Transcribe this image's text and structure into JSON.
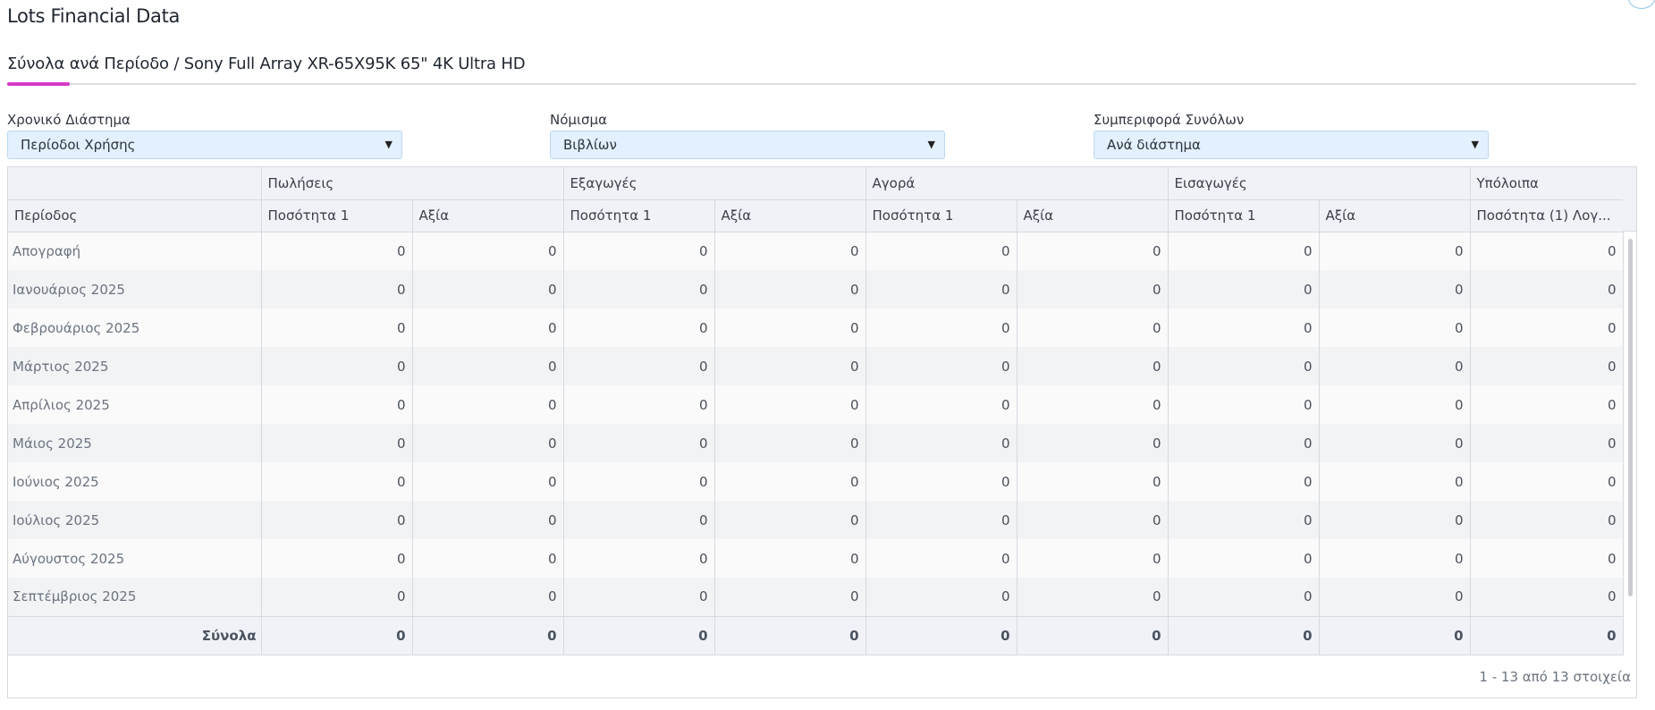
{
  "page_title": "Lots Financial Data",
  "tab": {
    "label": "Σύνολα ανά Περίοδο / Sony Full Array XR-65X95K 65\" 4K Ultra HD"
  },
  "filters": [
    {
      "label": "Χρονικό Διάστημα",
      "value": "Περίοδοι Χρήσης"
    },
    {
      "label": "Νόμισμα",
      "value": "Βιβλίων"
    },
    {
      "label": "Συμπεριφορά Συνόλων",
      "value": "Ανά διάστημα"
    }
  ],
  "grid": {
    "groups": [
      "Πωλήσεις",
      "Εξαγωγές",
      "Αγορά",
      "Εισαγωγές",
      "Υπόλοιπα"
    ],
    "columns": [
      "Περίοδος",
      "Ποσότητα 1",
      "Αξία",
      "Ποσότητα 1",
      "Αξία",
      "Ποσότητα 1",
      "Αξία",
      "Ποσότητα 1",
      "Αξία",
      "Ποσότητα (1) Λογ..."
    ],
    "rows": [
      {
        "period": "Απογραφή",
        "values": [
          "0",
          "0",
          "0",
          "0",
          "0",
          "0",
          "0",
          "0",
          "0"
        ]
      },
      {
        "period": "Ιανουάριος 2025",
        "values": [
          "0",
          "0",
          "0",
          "0",
          "0",
          "0",
          "0",
          "0",
          "0"
        ]
      },
      {
        "period": "Φεβρουάριος 2025",
        "values": [
          "0",
          "0",
          "0",
          "0",
          "0",
          "0",
          "0",
          "0",
          "0"
        ]
      },
      {
        "period": "Μάρτιος 2025",
        "values": [
          "0",
          "0",
          "0",
          "0",
          "0",
          "0",
          "0",
          "0",
          "0"
        ]
      },
      {
        "period": "Απρίλιος 2025",
        "values": [
          "0",
          "0",
          "0",
          "0",
          "0",
          "0",
          "0",
          "0",
          "0"
        ]
      },
      {
        "period": "Μάιος 2025",
        "values": [
          "0",
          "0",
          "0",
          "0",
          "0",
          "0",
          "0",
          "0",
          "0"
        ]
      },
      {
        "period": "Ιούνιος 2025",
        "values": [
          "0",
          "0",
          "0",
          "0",
          "0",
          "0",
          "0",
          "0",
          "0"
        ]
      },
      {
        "period": "Ιούλιος 2025",
        "values": [
          "0",
          "0",
          "0",
          "0",
          "0",
          "0",
          "0",
          "0",
          "0"
        ]
      },
      {
        "period": "Αύγουστος 2025",
        "values": [
          "0",
          "0",
          "0",
          "0",
          "0",
          "0",
          "0",
          "0",
          "0"
        ]
      },
      {
        "period": "Σεπτέμβριος 2025",
        "values": [
          "0",
          "0",
          "0",
          "0",
          "0",
          "0",
          "0",
          "0",
          "0"
        ]
      }
    ],
    "totals": {
      "label": "Σύνολα",
      "values": [
        "0",
        "0",
        "0",
        "0",
        "0",
        "0",
        "0",
        "0",
        "0"
      ]
    },
    "pager_info": "1 - 13 από 13 στοιχεία"
  },
  "icons": {
    "dropdown": "caret-down-icon"
  },
  "colors": {
    "tab_indicator": "#d63ac8",
    "select_bg": "#e3f0fd",
    "header_bg": "#f1f2f8"
  }
}
